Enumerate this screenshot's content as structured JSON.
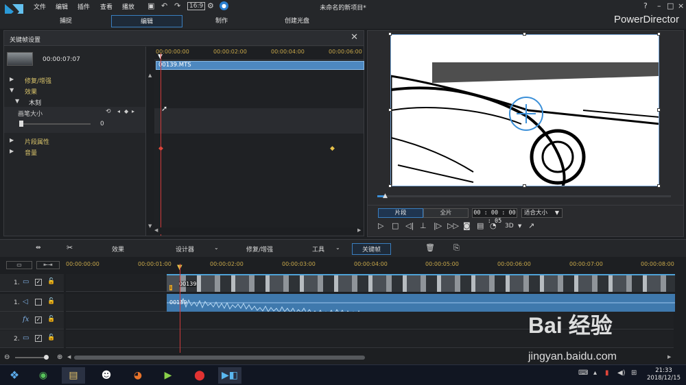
{
  "menu": [
    "文件",
    "编辑",
    "插件",
    "查看",
    "播放"
  ],
  "window_title": "未命名的新项目*",
  "window_controls": [
    "?",
    "–",
    "□",
    "×"
  ],
  "brand": "PowerDirector",
  "mode_tabs": [
    "捕捉",
    "编辑",
    "制作",
    "创建光盘"
  ],
  "active_mode_tab": "编辑",
  "keyframe_panel": {
    "title": "关键帧设置",
    "clip_time": "00:00:07:07",
    "ruler": [
      "00:00:00:00",
      "00:00:02:00",
      "00:00:04:00",
      "00:00:06:00"
    ],
    "clip_name": "00139.MTS",
    "tree": {
      "repair": "修复/增强",
      "effects": "效果",
      "effect_name": "木刻",
      "param": "画笔大小",
      "param_value": "0",
      "clip_props": "片段属性",
      "volume": "音量"
    }
  },
  "preview": {
    "seg_clip": "片段",
    "seg_movie": "全片",
    "timecode": "00 : 00 : 00 : 05",
    "fit": "适合大小",
    "threed": "3D"
  },
  "toolbar": {
    "effects": "效果",
    "designer": "设计器",
    "repair": "修复/增强",
    "tools": "工具",
    "keyframe": "关键帧"
  },
  "timeline": {
    "ruler": [
      "00:00:00:00",
      "00:00:01:00",
      "00:00:02:00",
      "00:00:03:00",
      "00:00:04:00",
      "00:00:05:00",
      "00:00:06:00",
      "00:00:07:00",
      "00:00:08:00"
    ],
    "tracks": [
      {
        "name": "1.",
        "icon": "video-track-icon"
      },
      {
        "name": "1.",
        "icon": "audio-track-icon"
      },
      {
        "name": "",
        "icon": "fx-track-icon"
      },
      {
        "name": "2.",
        "icon": "video-track-icon"
      }
    ],
    "video_clip_label": "00139",
    "audio_clip_label": "00139"
  },
  "taskbar": {
    "time": "21:33",
    "date": "2018/12/15"
  },
  "watermark": {
    "text": "Bai 经验",
    "url": "jingyan.baidu.com"
  },
  "colors": {
    "accent": "#3a7fc0",
    "clip_blue": "#4d88c0",
    "playhead": "#d23b3b",
    "ruler_text": "#c8a84a"
  }
}
